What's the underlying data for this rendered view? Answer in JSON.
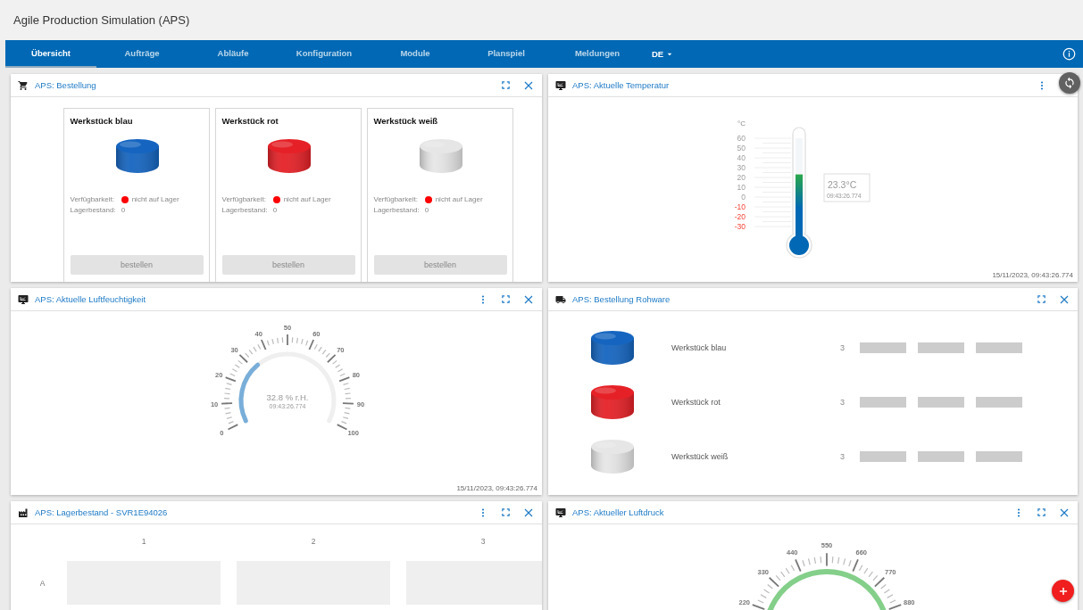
{
  "app_title": "Agile Production Simulation (APS)",
  "nav": {
    "tabs": [
      {
        "label": "Übersicht",
        "selected": true
      },
      {
        "label": "Aufträge",
        "selected": false
      },
      {
        "label": "Abläufe",
        "selected": false
      },
      {
        "label": "Konfiguration",
        "selected": false
      },
      {
        "label": "Module",
        "selected": false
      },
      {
        "label": "Planspiel",
        "selected": false
      },
      {
        "label": "Meldungen",
        "selected": false
      }
    ],
    "language": "DE"
  },
  "widgets": [
    {
      "kind": "order",
      "title": "APS: Bestellung",
      "menu": false,
      "close": true,
      "items": [
        {
          "name": "Werkstück blau",
          "color": "#1565c0",
          "availability_label": "Verfügbarkeit:",
          "in_stock": false,
          "status": "nicht auf Lager",
          "stock_label": "Lagerbestand:",
          "stock": "0",
          "button": "bestellen",
          "disabled": true
        },
        {
          "name": "Werkstück rot",
          "color": "#e52127",
          "availability_label": "Verfügbarkeit:",
          "in_stock": false,
          "status": "nicht auf Lager",
          "stock_label": "Lagerbestand:",
          "stock": "0",
          "button": "bestellen",
          "disabled": true
        },
        {
          "name": "Werkstück weiß",
          "color": "#e6e6e6",
          "availability_label": "Verfügbarkeit:",
          "in_stock": false,
          "status": "nicht auf Lager",
          "stock_label": "Lagerbestand:",
          "stock": "0",
          "button": "bestellen",
          "disabled": true
        }
      ]
    },
    {
      "kind": "temperature",
      "title": "APS: Aktuelle Temperatur",
      "menu": true,
      "close": false,
      "unit": "°C",
      "ticks": [
        {
          "label": "60",
          "warning": false
        },
        {
          "label": "50",
          "warning": false
        },
        {
          "label": "40",
          "warning": false
        },
        {
          "label": "30",
          "warning": false
        },
        {
          "label": "20",
          "warning": false
        },
        {
          "label": "10",
          "warning": false
        },
        {
          "label": "0",
          "warning": false
        },
        {
          "label": "-10",
          "warning": true
        },
        {
          "label": "-20",
          "warning": true
        },
        {
          "label": "-30",
          "warning": true
        }
      ],
      "level": 0.59,
      "reading": "23.3°C",
      "reading_time": "09:43:26.774",
      "timestamp": "15/11/2023, 09:43:26.774"
    },
    {
      "kind": "humidity",
      "title": "APS: Aktuelle Luftfeuchtigkeit",
      "menu": true,
      "close": true,
      "ticks": [
        "0",
        "10",
        "20",
        "30",
        "40",
        "50",
        "60",
        "70",
        "80",
        "90",
        "100"
      ],
      "level": 0.328,
      "reading": "32.8 % r.H.",
      "reading_time": "09:43:26.774",
      "timestamp": "15/11/2023, 09:43:26.774"
    },
    {
      "kind": "raw",
      "title": "APS: Bestellung Rohware",
      "menu": false,
      "close": true,
      "items": [
        {
          "name": "Werkstück blau",
          "color": "#1565c0",
          "count": "3"
        },
        {
          "name": "Werkstück rot",
          "color": "#e52127",
          "count": "3"
        },
        {
          "name": "Werkstück weiß",
          "color": "#e6e6e6",
          "count": "3"
        }
      ]
    },
    {
      "kind": "stock",
      "title": "APS: Lagerbestand - SVR1E94026",
      "menu": true,
      "close": true,
      "columns": [
        "1",
        "2",
        "3"
      ],
      "rows": [
        "A"
      ]
    },
    {
      "kind": "pressure",
      "title": "APS: Aktueller Luftdruck",
      "menu": true,
      "close": true,
      "ticks": [
        "220",
        "330",
        "440",
        "550",
        "660",
        "770",
        "880"
      ]
    }
  ]
}
